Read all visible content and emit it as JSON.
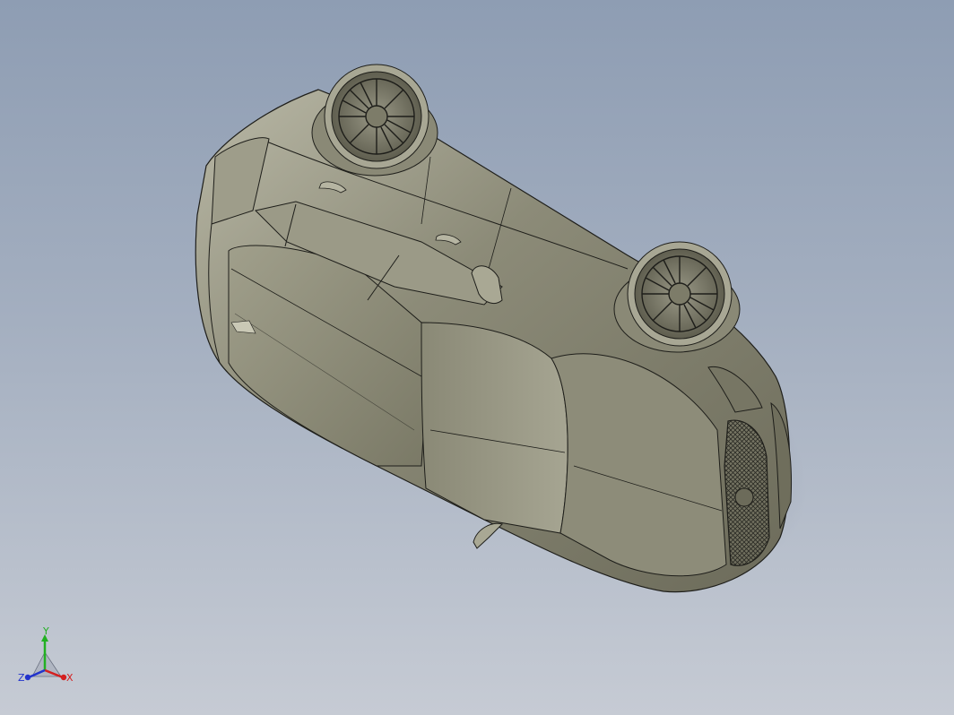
{
  "viewport": {
    "background_top": "#8e9db3",
    "background_bottom": "#c6cbd4"
  },
  "model": {
    "icon": "car-model",
    "body_color": "#8b8a76",
    "edge_color": "#1e1e1a"
  },
  "triad": {
    "x_label": "X",
    "y_label": "Y",
    "z_label": "Z",
    "x_color": "#d42020",
    "y_color": "#22b022",
    "z_color": "#2233cc"
  }
}
